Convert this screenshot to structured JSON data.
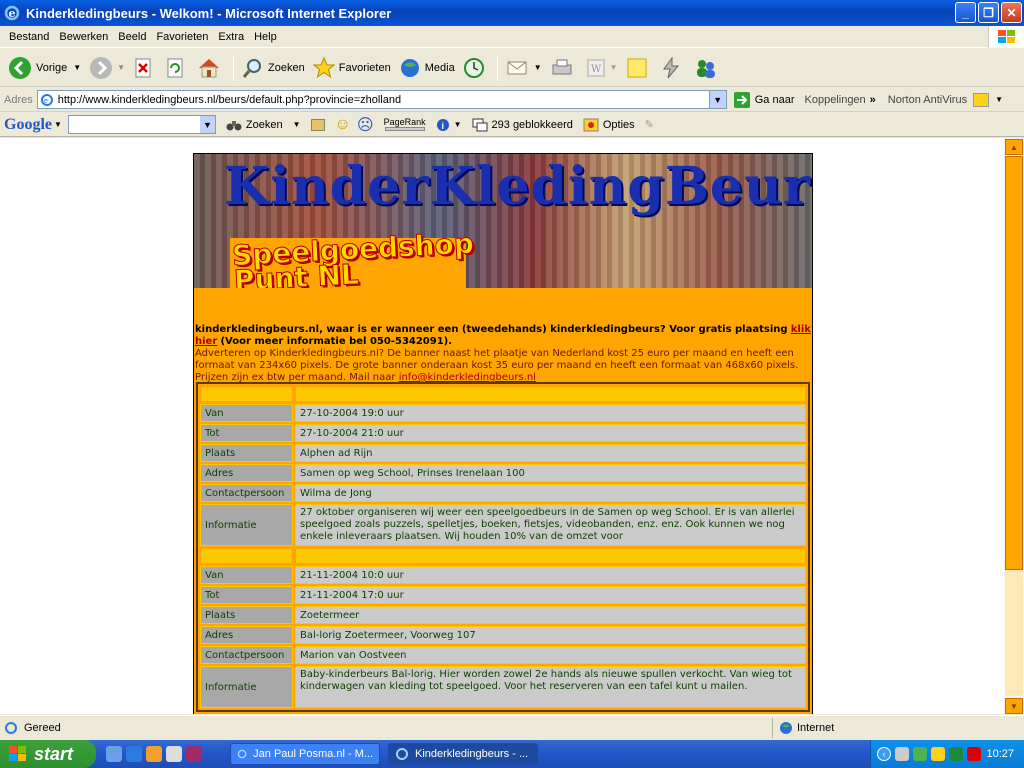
{
  "window": {
    "title": "Kinderkledingbeurs - Welkom! - Microsoft Internet Explorer",
    "accent": "#0A55D6"
  },
  "menu": [
    "Bestand",
    "Bewerken",
    "Beeld",
    "Favorieten",
    "Extra",
    "Help"
  ],
  "toolbar": {
    "back": "Vorige",
    "search": "Zoeken",
    "favorites": "Favorieten",
    "media": "Media"
  },
  "address": {
    "label": "Adres",
    "url": "http://www.kinderkledingbeurs.nl/beurs/default.php?provincie=zholland",
    "go": "Ga naar",
    "links": "Koppelingen",
    "antivirus": "Norton AntiVirus"
  },
  "googlebar": {
    "logo": "Google",
    "search": "Zoeken",
    "pagerank": "PageRank",
    "blocked": "293 geblokkeerd",
    "options": "Opties"
  },
  "page": {
    "banner_text": "KinderKledingBeurs",
    "logo_line1": "Speelgoedshop",
    "logo_line2": "Punt NL",
    "intro_bold": "kinderkledingbeurs.nl, waar is er wanneer een (tweedehands) kinderkledingbeurs? Voor gratis plaatsing",
    "intro_link": "klik hier",
    "intro_phone": "(Voor meer informatie bel 050-5342091).",
    "ad_text": "Adverteren op Kinderkledingbeurs.nl? De banner naast het plaatje van Nederland kost 25 euro per maand en heeft een formaat van 234x60 pixels. De grote banner onderaan kost 35 euro per maand en heeft een formaat van 468x60 pixels. Prijzen zijn ex btw per maand. Mail naar",
    "ad_email": "info@kinderkledingbeurs.nl"
  },
  "labels": {
    "van": "Van",
    "tot": "Tot",
    "plaats": "Plaats",
    "adres": "Adres",
    "contact": "Contactpersoon",
    "info": "Informatie"
  },
  "events": [
    {
      "van": "27-10-2004 19:0 uur",
      "tot": "27-10-2004 21:0 uur",
      "plaats": "Alphen ad Rijn",
      "adres": "Samen op weg School, Prinses Irenelaan 100",
      "contact": "Wilma de Jong",
      "info": "27 oktober organiseren wij weer een speelgoedbeurs in de Samen op weg School. Er is van allerlei speelgoed zoals puzzels, spelletjes, boeken, fietsjes, videobanden, enz. enz. Ook kunnen we nog enkele inleveraars plaatsen. Wij houden 10% van de omzet voor"
    },
    {
      "van": "21-11-2004 10:0 uur",
      "tot": "21-11-2004 17:0 uur",
      "plaats": "Zoetermeer",
      "adres": "Bal-lorig Zoetermeer, Voorweg 107",
      "contact": "Marion van Oostveen",
      "info": "Baby-kinderbeurs Bal-lorig. Hier worden zowel 2e hands als nieuwe spullen verkocht. Van wieg tot kinderwagen van kleding tot speelgoed. Voor het reserveren van een tafel kunt u mailen."
    }
  ],
  "status": {
    "text": "Gereed",
    "zone": "Internet"
  },
  "taskbar": {
    "start": "start",
    "task1": "Jan Paul Posma.nl - M...",
    "task2": "Kinderkledingbeurs - ...",
    "clock": "10:27"
  }
}
